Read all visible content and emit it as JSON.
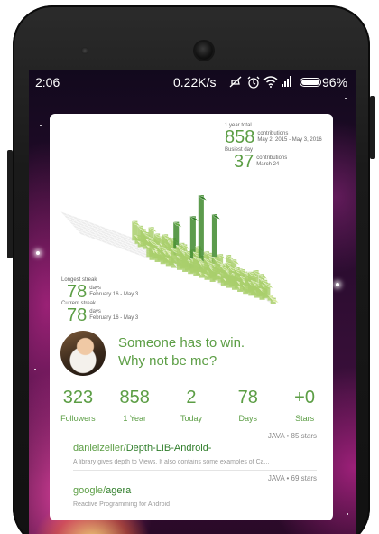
{
  "status_bar": {
    "time": "2:06",
    "network_speed": "0.22K/s",
    "battery_pct": "96%",
    "icons": [
      "mute-icon",
      "alarm-icon",
      "wifi-icon",
      "signal-icon",
      "battery-icon"
    ]
  },
  "summary": {
    "year_total_label": "1 year total",
    "year_total_value": "858",
    "contributions_label": "contributions",
    "year_range": "May 2, 2015 - May 3, 2016",
    "busiest_day_label": "Busiest day",
    "busiest_day_value": "37",
    "busiest_day_date": "March 24"
  },
  "streaks": {
    "longest_label": "Longest streak",
    "longest_value": "78",
    "longest_unit": "days",
    "longest_range": "February 16 - May 3",
    "current_label": "Current streak",
    "current_value": "78",
    "current_unit": "days",
    "current_range": "February 16 - May 3"
  },
  "profile": {
    "bio_line1": "Someone has to win.",
    "bio_line2": "Why not be me?"
  },
  "stats": [
    {
      "value": "323",
      "label": "Followers"
    },
    {
      "value": "858",
      "label": "1 Year"
    },
    {
      "value": "2",
      "label": "Today"
    },
    {
      "value": "78",
      "label": "Days"
    },
    {
      "value": "+0",
      "label": "Stars"
    }
  ],
  "repos": [
    {
      "meta": "JAVA • 85 stars",
      "owner": "danielzeller/",
      "name": "Depth-LIB-Android-",
      "description": "A library gives depth to Views. It also contains some examples of Ca..."
    },
    {
      "meta": "JAVA • 69 stars",
      "owner": "google/",
      "name": "agera",
      "description": "Reactive Programming for Android"
    }
  ],
  "colors": {
    "accent": "#5c9e45",
    "dark_green": "#2f7d2a",
    "light_green": "#c6e48b"
  }
}
